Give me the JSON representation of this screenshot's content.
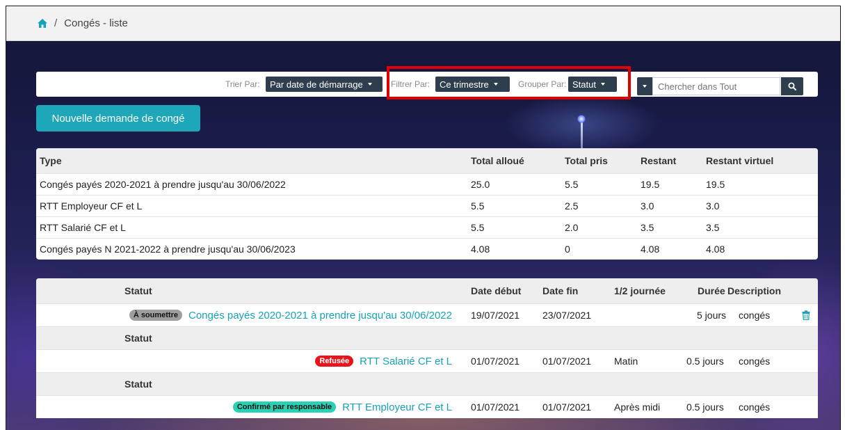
{
  "breadcrumb": {
    "separator": "/",
    "current": "Congés - liste"
  },
  "toolbar": {
    "sort_label": "Trier Par:",
    "sort_value": "Par date de démarrage",
    "filter_label": "Filtrer Par:",
    "filter_value": "Ce trimestre",
    "group_label": "Grouper Par:",
    "group_value": "Statut",
    "search_placeholder": "Chercher dans Tout"
  },
  "new_request_label": "Nouvelle demande de congé",
  "balances": {
    "headers": [
      "Type",
      "Total alloué",
      "Total pris",
      "Restant",
      "Restant virtuel"
    ],
    "rows": [
      [
        "Congés payés 2020-2021 à prendre jusqu'au 30/06/2022",
        "25.0",
        "5.5",
        "19.5",
        "19.5"
      ],
      [
        "RTT Employeur CF et L",
        "5.5",
        "2.5",
        "3.0",
        "3.0"
      ],
      [
        "RTT Salarié CF et L",
        "5.5",
        "2.0",
        "3.5",
        "3.5"
      ],
      [
        "Congés payés N 2021-2022 à prendre jusqu'au 30/06/2023",
        "4.08",
        "0",
        "4.08",
        "4.08"
      ]
    ]
  },
  "requests": {
    "headers": [
      "Statut",
      "Date début",
      "Date fin",
      "1/2 journée",
      "Durée",
      "Description"
    ],
    "group_label": "Statut",
    "rows": [
      {
        "status": "À soumettre",
        "status_color": "#9e9e9e",
        "type": "Congés payés 2020-2021 à prendre jusqu'au 30/06/2022",
        "start": "19/07/2021",
        "end": "23/07/2021",
        "half_day": "",
        "duration": "5 jours",
        "description": "congés"
      },
      {
        "status": "Refusée",
        "status_color": "#e8141c",
        "type": "RTT Salarié CF et L",
        "start": "01/07/2021",
        "end": "01/07/2021",
        "half_day": "Matin",
        "duration": "0.5 jours",
        "description": "congés"
      },
      {
        "status": "Confirmé par responsable",
        "status_color": "#2ad1b4",
        "type": "RTT Employeur CF et L",
        "start": "01/07/2021",
        "end": "01/07/2021",
        "half_day": "Après midi",
        "duration": "0.5 jours",
        "description": "congés"
      }
    ]
  },
  "colors": {
    "accent": "#1ea7b8",
    "dark_button": "#2f3e4e",
    "highlight": "#e00000",
    "link": "#17a2b8"
  },
  "icons": {
    "home": "home-icon",
    "search": "search-icon",
    "trash": "trash-icon",
    "caret": "caret-down-icon"
  }
}
